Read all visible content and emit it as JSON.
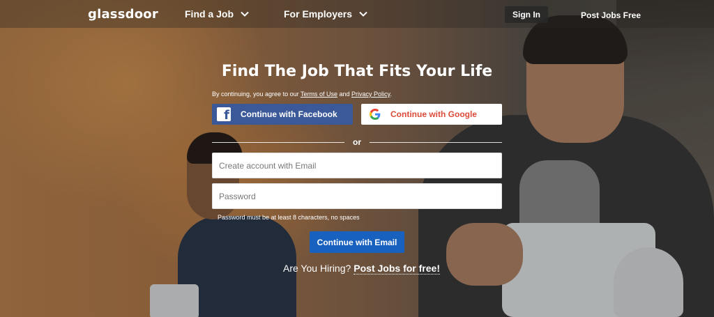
{
  "nav": {
    "logo": "glassdoor",
    "find_job": "Find a Job",
    "for_employers": "For Employers",
    "sign_in": "Sign In",
    "post_jobs": "Post Jobs Free"
  },
  "hero": {
    "headline": "Find The Job That Fits Your Life",
    "terms_prefix": "By continuing, you agree to our",
    "terms_link": "Terms of Use",
    "terms_and": "and",
    "privacy_link": "Privacy Policy",
    "terms_suffix": "."
  },
  "social": {
    "facebook_label": "Continue with Facebook",
    "google_label": "Continue with Google"
  },
  "divider": {
    "or": "or"
  },
  "form": {
    "email_placeholder": "Create account with Email",
    "password_placeholder": "Password",
    "password_hint": "Password must be at least 8 characters, no spaces",
    "submit_label": "Continue with Email"
  },
  "hiring": {
    "question": "Are You Hiring?",
    "link": "Post Jobs for free!"
  },
  "colors": {
    "facebook": "#3b5998",
    "google_text": "#dd4b39",
    "primary_button": "#1861bf"
  }
}
